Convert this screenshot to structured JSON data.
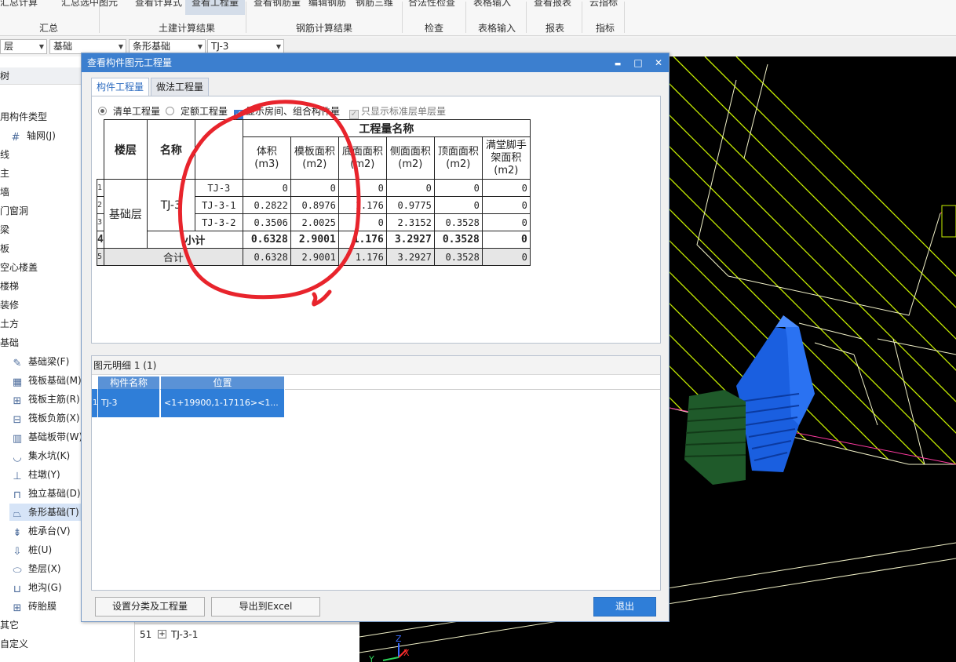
{
  "ribbon": {
    "top_items": [
      "汇总计算",
      "汇总选中图元",
      "查看计算式",
      "查看工程量",
      "查看钢筋量",
      "编辑钢筋",
      "钢筋三维",
      "合法性检查",
      "表格输入",
      "查看报表",
      "云指标"
    ],
    "groups": [
      "汇总",
      "土建计算结果",
      "钢筋计算结果",
      "检查",
      "表格输入",
      "报表",
      "指标"
    ]
  },
  "selectors": {
    "floor": "层",
    "category": "基础",
    "type": "条形基础",
    "component": "TJ-3"
  },
  "left_panel": {
    "header": "树",
    "items": [
      "用构件类型",
      "轴网(J)",
      "线",
      "主",
      "墙",
      "门窗洞",
      "梁",
      "板",
      "空心楼盖",
      "楼梯",
      "装修",
      "土方",
      "基础",
      "基础梁(F)",
      "筏板基础(M)",
      "筏板主筋(R)",
      "筏板负筋(X)",
      "基础板带(W)",
      "集水坑(K)",
      "柱墩(Y)",
      "独立基础(D)",
      "条形基础(T)",
      "桩承台(V)",
      "桩(U)",
      "垫层(X)",
      "地沟(G)",
      "砖胎膜",
      "其它",
      "自定义"
    ],
    "selected": "条形基础(T)"
  },
  "subgrid": {
    "row_number": "51",
    "expander": "+",
    "name": "TJ-3-1"
  },
  "dialog": {
    "title": "查看构件图元工程量",
    "win_minimize": "▬",
    "win_maximize": "□",
    "win_close": "✕",
    "tabs": [
      "构件工程量",
      "做法工程量"
    ],
    "options": {
      "list_qty": "清单工程量",
      "quota_qty": "定额工程量",
      "show_rooms": "显示房间、组合构件量",
      "std_floor_only": "只显示标准层单层量"
    },
    "table": {
      "col_floor": "楼层",
      "col_name": "名称",
      "group_header": "工程量名称",
      "sub_headers": [
        "体积(m3)",
        "模板面积(m2)",
        "底面面积(m2)",
        "侧面面积(m2)",
        "顶面面积(m2)",
        "满堂脚手架面积(m2)"
      ],
      "row_numbers": [
        "1",
        "2",
        "3",
        "4",
        "5"
      ],
      "floor": "基础层",
      "group_name": "TJ-3",
      "rows": [
        {
          "name": "TJ-3",
          "values": [
            "0",
            "0",
            "0",
            "0",
            "0",
            "0"
          ]
        },
        {
          "name": "TJ-3-1",
          "values": [
            "0.2822",
            "0.8976",
            "1.176",
            "0.9775",
            "0",
            "0"
          ]
        },
        {
          "name": "TJ-3-2",
          "values": [
            "0.3506",
            "2.0025",
            "0",
            "2.3152",
            "0.3528",
            "0"
          ]
        }
      ],
      "subtotal_label": "小计",
      "subtotal": [
        "0.6328",
        "2.9001",
        "1.176",
        "3.2927",
        "0.3528",
        "0"
      ],
      "total_label": "合计",
      "total": [
        "0.6328",
        "2.9001",
        "1.176",
        "3.2927",
        "0.3528",
        "0"
      ]
    },
    "detail": {
      "header": "图元明细  1 (1)",
      "columns": [
        "构件名称",
        "位置"
      ],
      "row_number": "1",
      "row": {
        "name": "TJ-3",
        "position": "<1+19900,1-17116><1..."
      }
    },
    "buttons": {
      "settings": "设置分类及工程量",
      "export": "导出到Excel",
      "exit": "退出"
    }
  },
  "axis": {
    "x": "X",
    "y": "Y",
    "z": "Z"
  },
  "colors": {
    "dialog_title": "#3c7fcf",
    "selection": "#2f7ed8",
    "hatch": "#c8f000",
    "annotation_circle": "#e8242c",
    "block_blue": "#1a5fe0",
    "block_green": "#1f5a2a"
  }
}
